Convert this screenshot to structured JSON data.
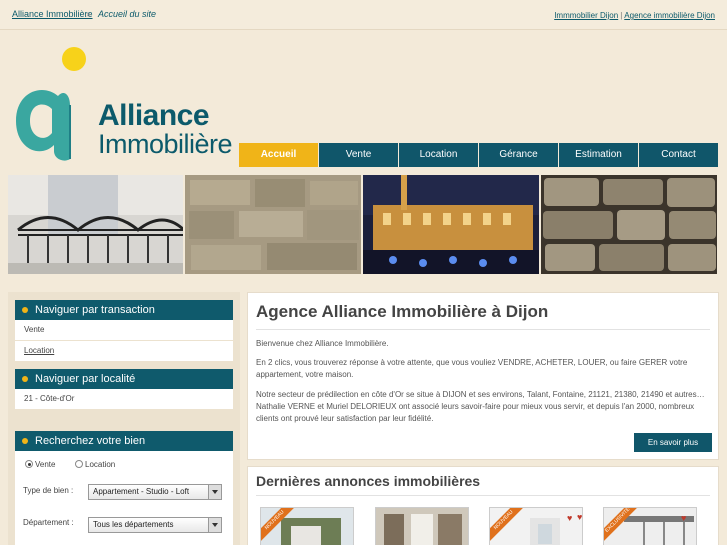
{
  "breadcrumb": {
    "home": "Alliance Immobilière",
    "separator": "»",
    "current": "Accueil du site"
  },
  "top_links": {
    "link1": "Immmobilier Dijon",
    "link2": "Agence immobilière Dijon"
  },
  "logo": {
    "line1": "Alliance",
    "line2": "Immobilière"
  },
  "nav": [
    "Accueil",
    "Vente",
    "Location",
    "Gérance",
    "Estimation",
    "Contact"
  ],
  "sidebar": {
    "transaction_title": "Naviguer par transaction",
    "transaction_items": [
      "Vente",
      "Location"
    ],
    "localite_title": "Naviguer par localité",
    "localite_items": [
      "21 - Côte-d'Or"
    ],
    "search_title": "Recherchez votre bien",
    "radio_vente": "Vente",
    "radio_location": "Location",
    "type_label": "Type de bien :",
    "type_value": "Appartement - Studio - Loft",
    "dept_label": "Département :",
    "dept_value": "Tous les départements"
  },
  "main": {
    "title": "Agence Alliance Immobilière à Dijon",
    "p1": "Bienvenue chez Alliance Immobilière.",
    "p2": "En 2 clics, vous trouverez réponse à votre attente, que vous vouliez VENDRE, ACHETER, LOUER, ou faire GERER votre appartement, votre maison.",
    "p3": "Notre secteur de prédilection en côte d'Or se situe à DIJON et ses environs, Talant, Fontaine, 21121, 21380, 21490 et autres… Nathalie VERNE et Muriel DELORIEUX ont associé leurs savoir-faire pour mieux vous servir, et depuis l'an 2000, nombreux clients ont prouvé leur satisfaction par leur fidélité.",
    "more_button": "En savoir plus"
  },
  "annonces": {
    "title": "Dernières annonces immobilières",
    "ribbons": [
      "NOUVEAU",
      "",
      "NOUVEAU",
      "EXCLUSIVITÉ"
    ]
  },
  "colors": {
    "teal": "#10566a",
    "gold": "#f0b418",
    "background": "#f3ead9"
  }
}
